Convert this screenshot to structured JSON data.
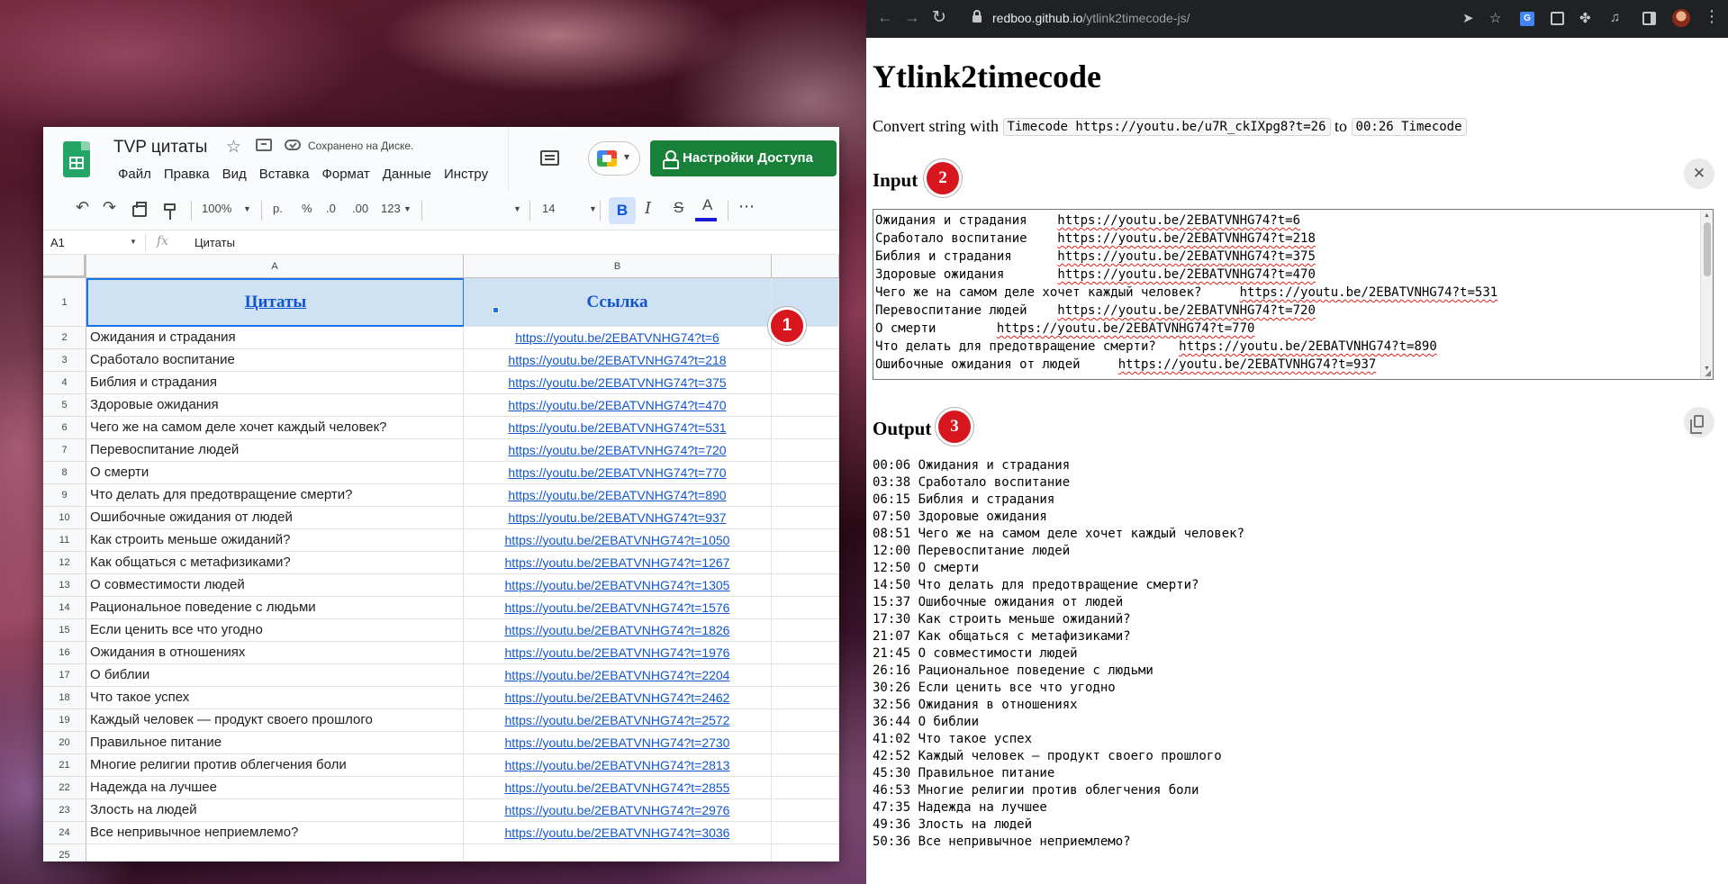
{
  "sheets": {
    "title": "TVP цитаты",
    "save_status": "Сохранено на Диске.",
    "menu": [
      "Файл",
      "Правка",
      "Вид",
      "Вставка",
      "Формат",
      "Данные",
      "Инстру"
    ],
    "share_label": "Настройки Доступа",
    "toolbar": {
      "zoom": "100%",
      "currency": "р.",
      "percent": "%",
      "dec_minus": ".0",
      "dec_plus": ".00",
      "format": "123",
      "font_size": "14",
      "bold": "B",
      "italic": "I",
      "strike": "S",
      "text_color": "A",
      "more": "⋯"
    },
    "cell_ref": "A1",
    "fx": "fx",
    "formula_value": "Цитаты",
    "columns": [
      "A",
      "B"
    ],
    "header": {
      "row": "1",
      "a": "Цитаты",
      "b": "Ссылка"
    },
    "rows": [
      {
        "n": "2",
        "a": "Ожидания и страдания",
        "b": "https://youtu.be/2EBATVNHG74?t=6"
      },
      {
        "n": "3",
        "a": "Сработало воспитание",
        "b": "https://youtu.be/2EBATVNHG74?t=218"
      },
      {
        "n": "4",
        "a": "Библия и страдания",
        "b": "https://youtu.be/2EBATVNHG74?t=375"
      },
      {
        "n": "5",
        "a": "Здоровые ожидания",
        "b": "https://youtu.be/2EBATVNHG74?t=470"
      },
      {
        "n": "6",
        "a": "Чего же на самом деле хочет каждый человек?",
        "b": "https://youtu.be/2EBATVNHG74?t=531"
      },
      {
        "n": "7",
        "a": "Перевоспитание людей",
        "b": "https://youtu.be/2EBATVNHG74?t=720"
      },
      {
        "n": "8",
        "a": "О смерти",
        "b": "https://youtu.be/2EBATVNHG74?t=770"
      },
      {
        "n": "9",
        "a": "Что делать для предотвращение смерти?",
        "b": "https://youtu.be/2EBATVNHG74?t=890"
      },
      {
        "n": "10",
        "a": "Ошибочные ожидания от людей",
        "b": "https://youtu.be/2EBATVNHG74?t=937"
      },
      {
        "n": "11",
        "a": "Как строить меньше ожиданий?",
        "b": "https://youtu.be/2EBATVNHG74?t=1050"
      },
      {
        "n": "12",
        "a": "Как общаться с метафизиками?",
        "b": "https://youtu.be/2EBATVNHG74?t=1267"
      },
      {
        "n": "13",
        "a": "О совместимости людей",
        "b": "https://youtu.be/2EBATVNHG74?t=1305"
      },
      {
        "n": "14",
        "a": "Рациональное поведение с людьми",
        "b": "https://youtu.be/2EBATVNHG74?t=1576"
      },
      {
        "n": "15",
        "a": "Если ценить все что угодно",
        "b": "https://youtu.be/2EBATVNHG74?t=1826"
      },
      {
        "n": "16",
        "a": "Ожидания в отношениях",
        "b": "https://youtu.be/2EBATVNHG74?t=1976"
      },
      {
        "n": "17",
        "a": "О библии",
        "b": "https://youtu.be/2EBATVNHG74?t=2204"
      },
      {
        "n": "18",
        "a": "Что такое успех",
        "b": "https://youtu.be/2EBATVNHG74?t=2462"
      },
      {
        "n": "19",
        "a": "Каждый человек — продукт своего прошлого",
        "b": "https://youtu.be/2EBATVNHG74?t=2572"
      },
      {
        "n": "20",
        "a": "Правильное питание",
        "b": "https://youtu.be/2EBATVNHG74?t=2730"
      },
      {
        "n": "21",
        "a": "Многие религии против облегчения боли",
        "b": "https://youtu.be/2EBATVNHG74?t=2813"
      },
      {
        "n": "22",
        "a": "Надежда на лучшее",
        "b": "https://youtu.be/2EBATVNHG74?t=2855"
      },
      {
        "n": "23",
        "a": "Злость на людей",
        "b": "https://youtu.be/2EBATVNHG74?t=2976"
      },
      {
        "n": "24",
        "a": "Все непривычное неприемлемо?",
        "b": "https://youtu.be/2EBATVNHG74?t=3036"
      },
      {
        "n": "25",
        "a": "",
        "b": ""
      }
    ]
  },
  "badges": [
    "1",
    "2",
    "3"
  ],
  "browser": {
    "url_host": "redboo.github.io",
    "url_path": "/ytlink2timecode-js/",
    "translate_glyph": "G"
  },
  "page": {
    "title": "Ytlink2timecode",
    "convert_prefix": "Convert string with",
    "convert_from": "Timecode https://youtu.be/u7R_ckIXpg8?t=26",
    "convert_mid": "to",
    "convert_to": "00:26 Timecode",
    "input_title": "Input",
    "output_title": "Output",
    "close_glyph": "✕",
    "input_lines": [
      {
        "text": "Ожидания и страдания",
        "sep": "    ",
        "link": "https://youtu.be/2EBATVNHG74?t=6"
      },
      {
        "text": "Сработало воспитание",
        "sep": "    ",
        "link": "https://youtu.be/2EBATVNHG74?t=218"
      },
      {
        "text": "Библия и страдания",
        "sep": "      ",
        "link": "https://youtu.be/2EBATVNHG74?t=375"
      },
      {
        "text": "Здоровые ожидания",
        "sep": "       ",
        "link": "https://youtu.be/2EBATVNHG74?t=470"
      },
      {
        "text": "Чего же на самом деле хочет каждый человек?",
        "sep": "     ",
        "link": "https://youtu.be/2EBATVNHG74?t=531"
      },
      {
        "text": "Перевоспитание людей",
        "sep": "    ",
        "link": "https://youtu.be/2EBATVNHG74?t=720"
      },
      {
        "text": "О смерти",
        "sep": "        ",
        "link": "https://youtu.be/2EBATVNHG74?t=770"
      },
      {
        "text": "Что делать для предотвращение смерти?",
        "sep": "   ",
        "link": "https://youtu.be/2EBATVNHG74?t=890"
      },
      {
        "text": "Ошибочные ожидания от людей",
        "sep": "     ",
        "link": "https://youtu.be/2EBATVNHG74?t=937"
      }
    ],
    "output_lines": [
      "00:06 Ожидания и страдания",
      "03:38 Сработало воспитание",
      "06:15 Библия и страдания",
      "07:50 Здоровые ожидания",
      "08:51 Чего же на самом деле хочет каждый человек?",
      "12:00 Перевоспитание людей",
      "12:50 О смерти",
      "14:50 Что делать для предотвращение смерти?",
      "15:37 Ошибочные ожидания от людей",
      "17:30 Как строить меньше ожиданий?",
      "21:07 Как общаться с метафизиками?",
      "21:45 О совместимости людей",
      "26:16 Рациональное поведение с людьми",
      "30:26 Если ценить все что угодно",
      "32:56 Ожидания в отношениях",
      "36:44 О библии",
      "41:02 Что такое успех",
      "42:52 Каждый человек — продукт своего прошлого",
      "45:30 Правильное питание",
      "46:53 Многие религии против облегчения боли",
      "47:35 Надежда на лучшее",
      "49:36 Злость на людей",
      "50:36 Все непривычное неприемлемо?"
    ]
  }
}
